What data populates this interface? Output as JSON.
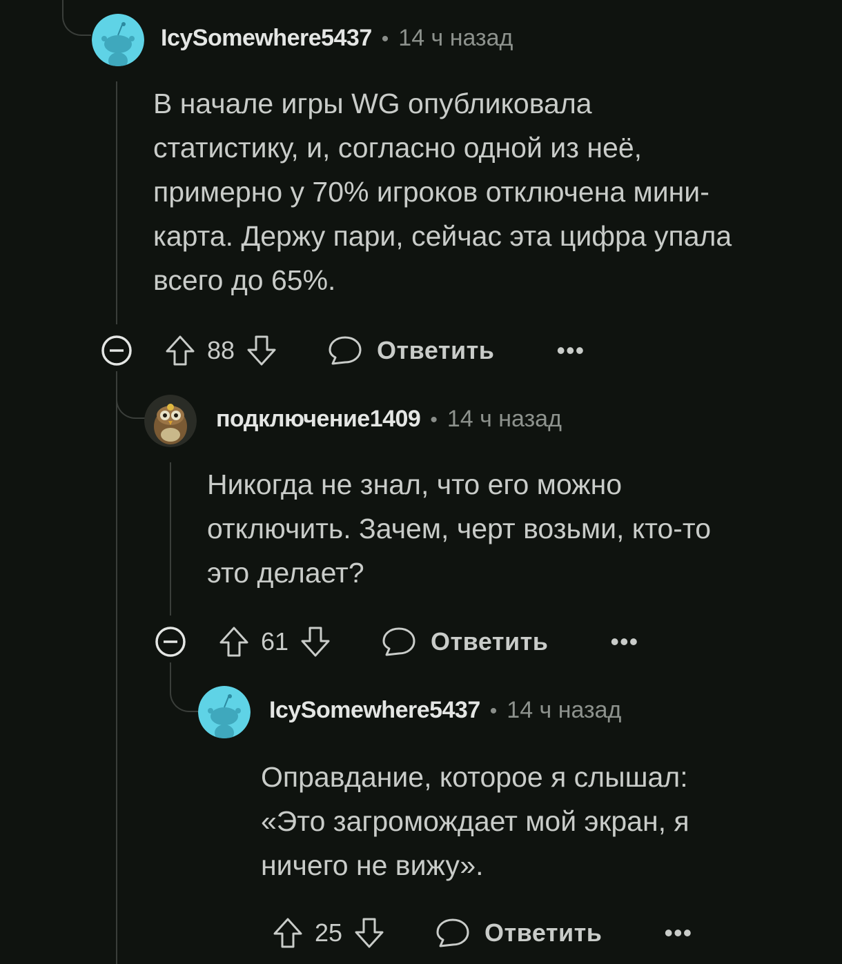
{
  "comments": [
    {
      "username": "IcySomewhere5437",
      "separator": "•",
      "time": "14 ч назад",
      "avatar": "reddit-snoo-avatar-cyan",
      "lines": [
        "В начале игры WG опубликовала",
        "статистику, и, согласно одной из неё,",
        "примерно у 70% игроков отключена мини-",
        "карта. Держу пари, сейчас эта цифра упала",
        "всего до 65%."
      ],
      "score": "88",
      "reply_label": "Ответить",
      "more_label": "•••"
    },
    {
      "username": "подключение1409",
      "separator": "•",
      "time": "14 ч назад",
      "avatar": "custom-owl-avatar",
      "lines": [
        "Никогда не знал, что его можно",
        "отключить. Зачем, черт возьми, кто-то",
        "это делает?"
      ],
      "score": "61",
      "reply_label": "Ответить",
      "more_label": "•••"
    },
    {
      "username": "IcySomewhere5437",
      "separator": "•",
      "time": "14 ч назад",
      "avatar": "reddit-snoo-avatar-cyan",
      "lines": [
        "Оправдание, которое я слышал:",
        "«Это загромождает мой экран, я",
        "ничего не вижу»."
      ],
      "score": "25",
      "reply_label": "Ответить",
      "more_label": "•••"
    }
  ],
  "colors": {
    "background": "#0f130f",
    "thread_line": "#3a3e3a",
    "avatar_cyan": "#5fd3e6",
    "text": "#c9ccc9",
    "muted": "#8d928d"
  }
}
